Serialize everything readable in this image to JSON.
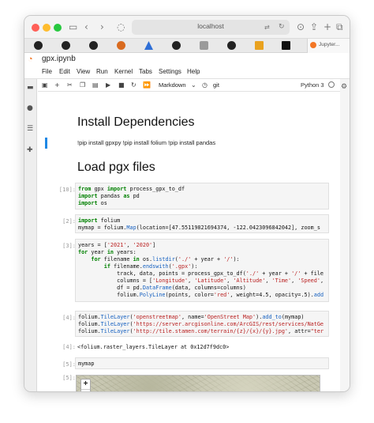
{
  "browser": {
    "url": "localhost",
    "active_tab_label": "Jupyter...",
    "icons": [
      "back-icon",
      "forward-icon",
      "shield-icon",
      "translate-icon",
      "refresh-icon",
      "download-icon",
      "share-icon",
      "new-tab-icon",
      "tabs-overview-icon"
    ]
  },
  "jupyter": {
    "logo": "jupyter-logo",
    "filename": "gpx.ipynb",
    "menu": [
      "File",
      "Edit",
      "View",
      "Run",
      "Kernel",
      "Tabs",
      "Settings",
      "Help"
    ],
    "toolbar": {
      "cell_type": "Markdown",
      "git_label": "git",
      "kernel": "Python 3"
    }
  },
  "notebook": {
    "heading1": "Install Dependencies",
    "install_text": "!pip install gpxpy !pip install folium !pip install pandas",
    "heading2": "Load pgx files",
    "cells": [
      {
        "prompt": "[10]:"
      },
      {
        "prompt": "[2]:"
      },
      {
        "prompt": "[3]:"
      },
      {
        "prompt": "[4]:",
        "output": "<folium.raster_layers.TileLayer at 0x12d7f9dc0>"
      },
      {
        "prompt": "[5]:"
      },
      {
        "prompt": "[5]:"
      }
    ],
    "code": {
      "c10_l1": {
        "kw1": "from",
        "t1": " gpx ",
        "kw2": "import",
        "t2": " process_gpx_to_df"
      },
      "c10_l2": {
        "kw1": "import",
        "t1": " pandas ",
        "kw2": "as",
        "t2": " pd"
      },
      "c10_l3": {
        "kw1": "import",
        "t1": " os"
      },
      "c2_l1": {
        "kw1": "import",
        "t1": " folium"
      },
      "c2_l2": {
        "t1": "mymap = folium.",
        "fn": "Map",
        "t2": "(location=[47.55119821694374, -122.0423096842042], zoom_s"
      },
      "c3_l1": {
        "t1": "years = [",
        "s1": "'2021'",
        "t2": ", ",
        "s2": "'2020'",
        "t3": "]"
      },
      "c3_l2": {
        "kw1": "for",
        "t1": " year ",
        "kw2": "in",
        "t2": " years:"
      },
      "c3_l3": {
        "indent": "    ",
        "kw1": "for",
        "t1": " filename ",
        "kw2": "in",
        "t2": " os.",
        "fn": "listdir",
        "t3": "(",
        "s1": "'./'",
        "t4": " + year + ",
        "s2": "'/'",
        "t5": "):"
      },
      "c3_l4": {
        "indent": "        ",
        "kw1": "if",
        "t1": " filename.",
        "fn": "endswith",
        "t2": "(",
        "s1": "'.gpx'",
        "t3": "):"
      },
      "c3_l5": {
        "indent": "            ",
        "t1": "track, data, points = process_gpx_to_df(",
        "s1": "'./'",
        "t2": " + year + ",
        "s2": "'/'",
        "t3": " + file"
      },
      "c3_l6": {
        "indent": "            ",
        "t1": "columns = [",
        "s1": "'Longitude'",
        "t2": ", ",
        "s2": "'Latitude'",
        "t3": ", ",
        "s3": "'Altitude'",
        "t4": ", ",
        "s4": "'Time'",
        "t5": ", ",
        "s5": "'Speed'",
        "t6": ","
      },
      "c3_l7": {
        "indent": "            ",
        "t1": "df = pd.",
        "fn": "DataFrame",
        "t2": "(data, columns=columns)"
      },
      "c3_l8": {
        "indent": "            ",
        "t1": "folium.",
        "fn": "PolyLine",
        "t2": "(points, color=",
        "s1": "'red'",
        "t3": ", weight=4.5, opacity=.5).",
        "fn2": "add"
      },
      "c4_l1": {
        "t1": "folium.",
        "fn": "TileLayer",
        "t2": "(",
        "s1": "'openstreetmap'",
        "t3": ", name=",
        "s2": "'OpenStreet Map'",
        "t4": ").",
        "fn2": "add_to",
        "t5": "(mymap)"
      },
      "c4_l2": {
        "t1": "folium.",
        "fn": "TileLayer",
        "t2": "(",
        "s1": "'https://server.arcgisonline.com/ArcGIS/rest/services/NatGe"
      },
      "c4_l3": {
        "t1": "folium.",
        "fn": "TileLayer",
        "t2": "(",
        "s1": "'http://tile.stamen.com/terrain/{z}/{x}/{y}.jpg'",
        "t3": ", attr=",
        "s2": "\"ter"
      },
      "c5_l1": {
        "t1": "mymap"
      }
    },
    "map": {
      "zoom_in": "+",
      "zoom_out": "−"
    }
  }
}
